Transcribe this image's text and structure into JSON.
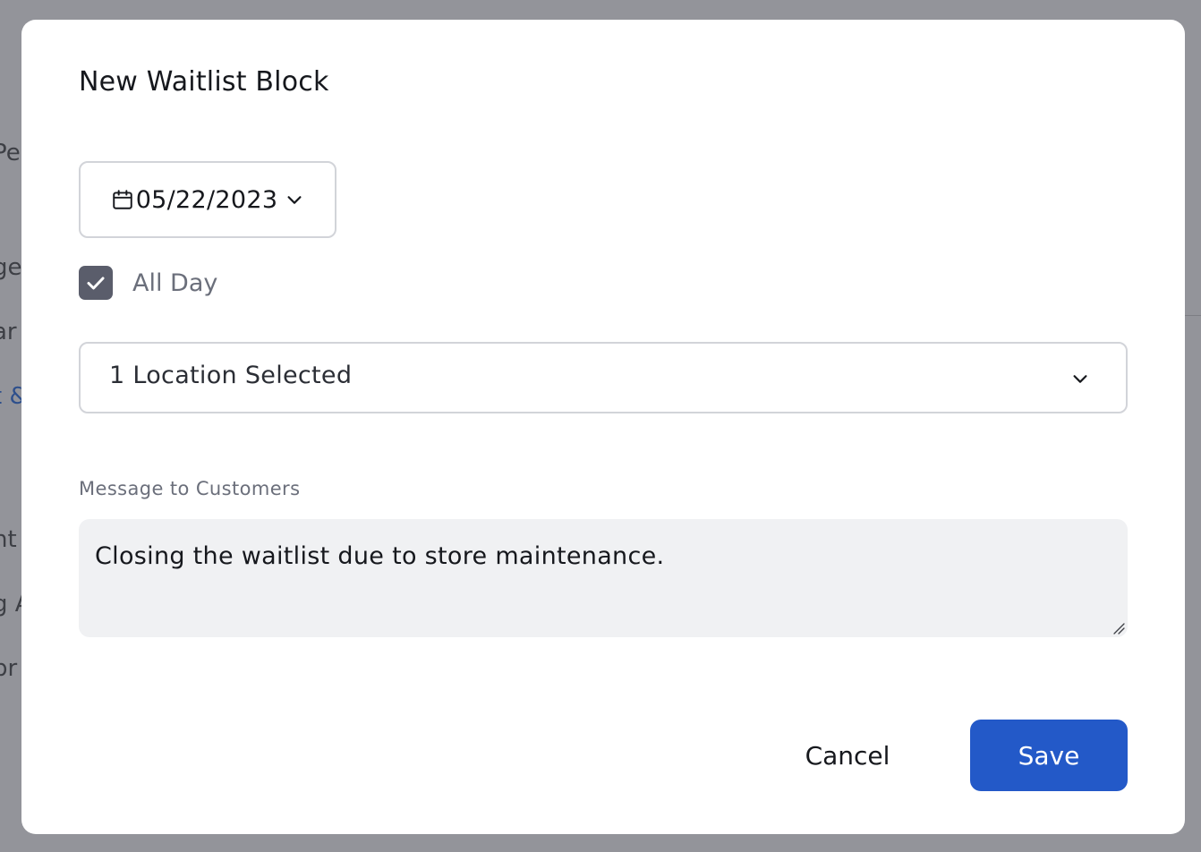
{
  "background": {
    "fragments": [
      "Pe",
      "ge",
      "ar",
      "t &",
      "nt",
      "g A",
      "br"
    ]
  },
  "modal": {
    "title": "New Waitlist Block",
    "date": {
      "value": "05/22/2023",
      "icon": "calendar-icon"
    },
    "all_day": {
      "label": "All Day",
      "checked": true
    },
    "location": {
      "selected_text": "1 Location Selected",
      "icon": "chevron-down-icon"
    },
    "message": {
      "label": "Message to Customers",
      "value": "Closing the waitlist due to store maintenance."
    },
    "actions": {
      "cancel_label": "Cancel",
      "save_label": "Save"
    }
  },
  "colors": {
    "primary": "#2359c8",
    "checkbox": "#5a5d6b",
    "overlay": "#93949a"
  }
}
